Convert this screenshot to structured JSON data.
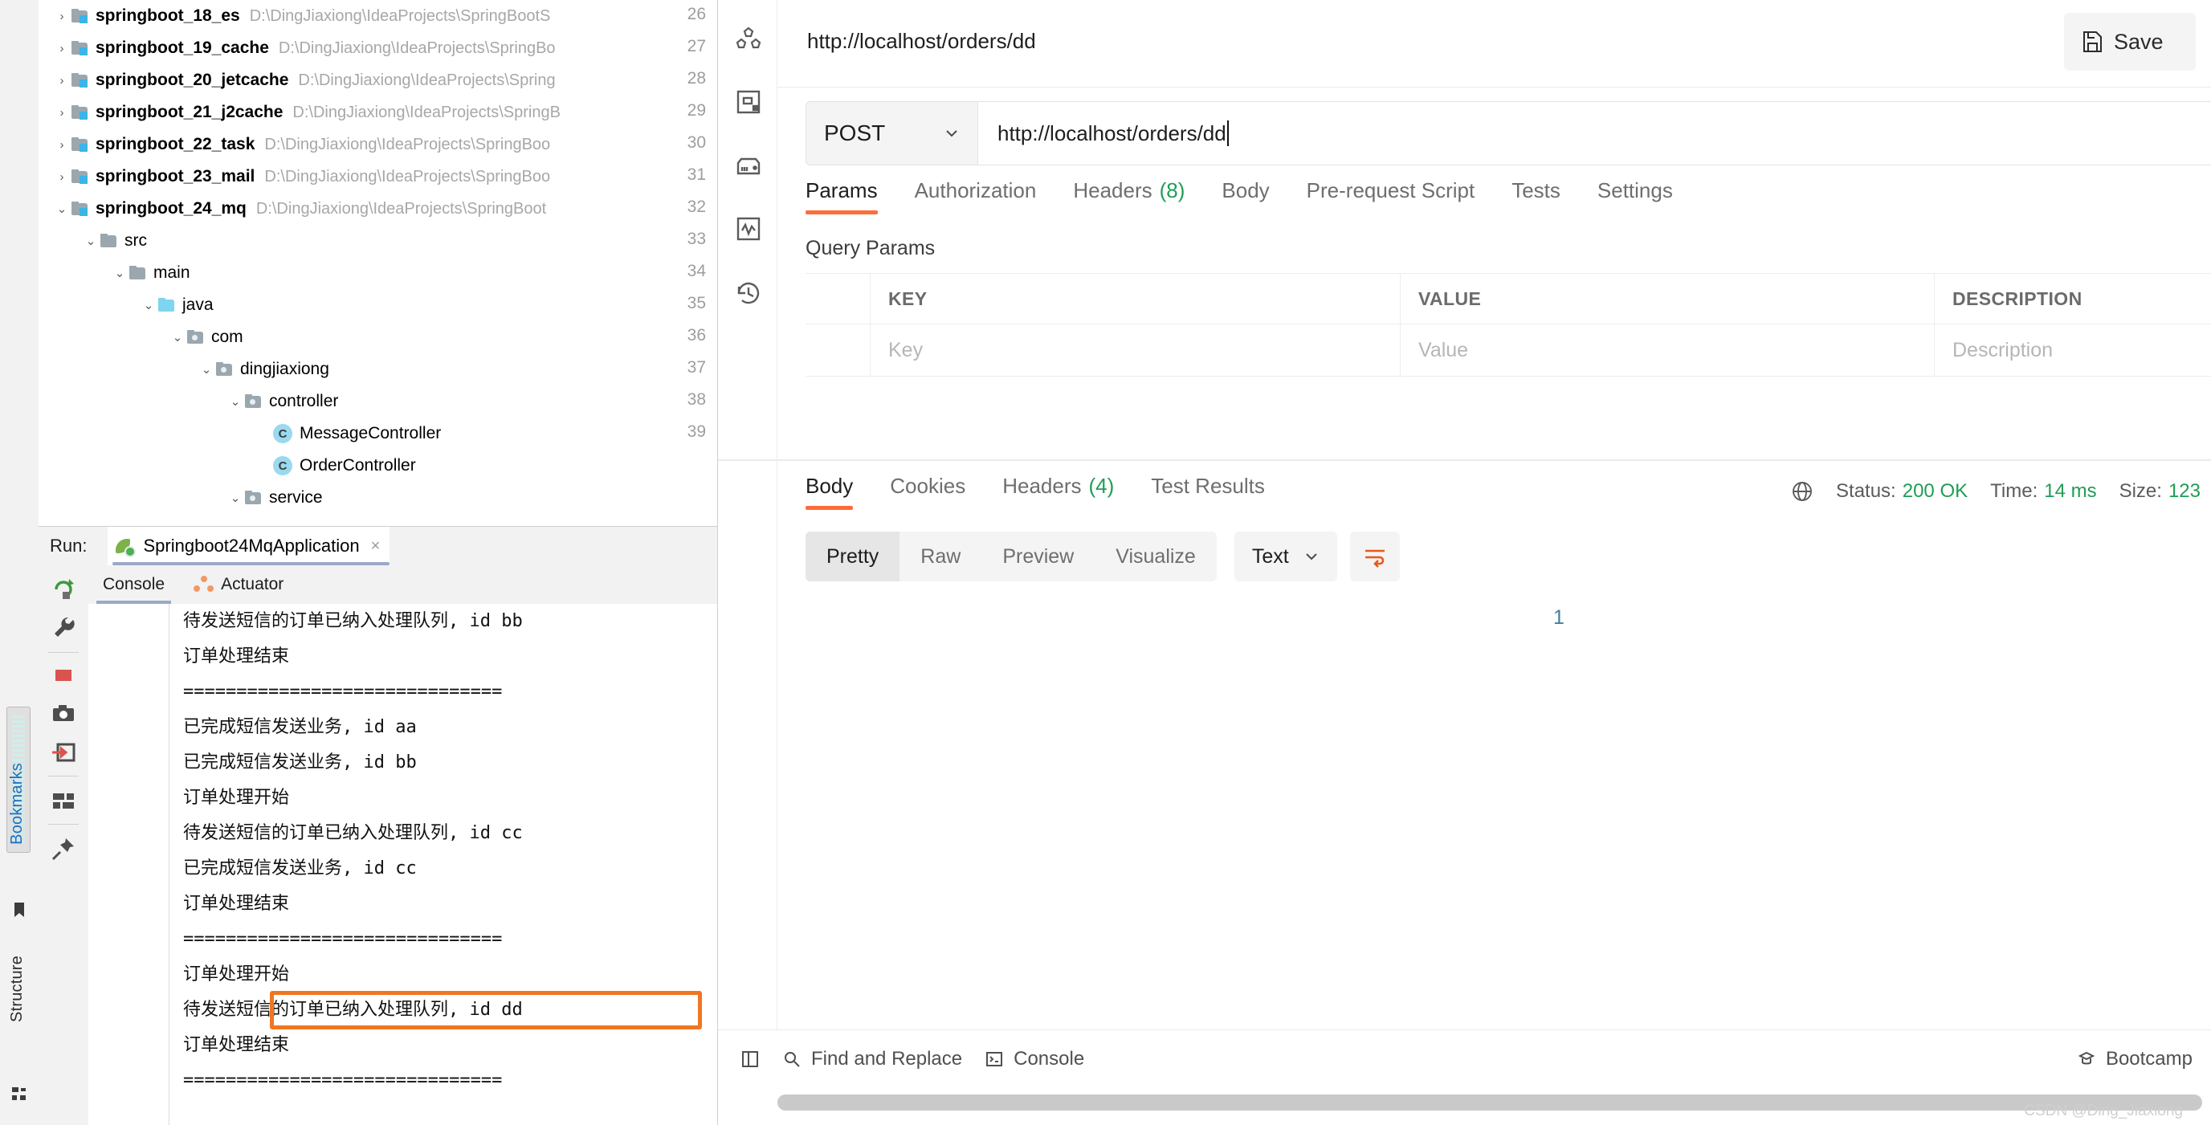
{
  "ide": {
    "rail": {
      "bookmarks_label": "Bookmarks",
      "structure_label": "Structure"
    },
    "tree": [
      {
        "name": "springboot_18_es",
        "path": "D:\\DingJiaxiong\\IdeaProjects\\SpringBootS",
        "indent": 0,
        "chevron": "›",
        "kind": "module"
      },
      {
        "name": "springboot_19_cache",
        "path": "D:\\DingJiaxiong\\IdeaProjects\\SpringBo",
        "indent": 0,
        "chevron": "›",
        "kind": "module"
      },
      {
        "name": "springboot_20_jetcache",
        "path": "D:\\DingJiaxiong\\IdeaProjects\\Spring",
        "indent": 0,
        "chevron": "›",
        "kind": "module"
      },
      {
        "name": "springboot_21_j2cache",
        "path": "D:\\DingJiaxiong\\IdeaProjects\\SpringB",
        "indent": 0,
        "chevron": "›",
        "kind": "module"
      },
      {
        "name": "springboot_22_task",
        "path": "D:\\DingJiaxiong\\IdeaProjects\\SpringBoo",
        "indent": 0,
        "chevron": "›",
        "kind": "module"
      },
      {
        "name": "springboot_23_mail",
        "path": "D:\\DingJiaxiong\\IdeaProjects\\SpringBoo",
        "indent": 0,
        "chevron": "›",
        "kind": "module"
      },
      {
        "name": "springboot_24_mq",
        "path": "D:\\DingJiaxiong\\IdeaProjects\\SpringBoot",
        "indent": 0,
        "chevron": "⌄",
        "kind": "module"
      },
      {
        "name": "src",
        "path": "",
        "indent": 1,
        "chevron": "⌄",
        "kind": "folder"
      },
      {
        "name": "main",
        "path": "",
        "indent": 2,
        "chevron": "⌄",
        "kind": "folder"
      },
      {
        "name": "java",
        "path": "",
        "indent": 3,
        "chevron": "⌄",
        "kind": "java"
      },
      {
        "name": "com",
        "path": "",
        "indent": 4,
        "chevron": "⌄",
        "kind": "package"
      },
      {
        "name": "dingjiaxiong",
        "path": "",
        "indent": 5,
        "chevron": "⌄",
        "kind": "package"
      },
      {
        "name": "controller",
        "path": "",
        "indent": 6,
        "chevron": "⌄",
        "kind": "package"
      },
      {
        "name": "MessageController",
        "path": "",
        "indent": 7,
        "chevron": "",
        "kind": "class"
      },
      {
        "name": "OrderController",
        "path": "",
        "indent": 7,
        "chevron": "",
        "kind": "class"
      },
      {
        "name": "service",
        "path": "",
        "indent": 6,
        "chevron": "⌄",
        "kind": "package"
      }
    ],
    "gutter_lines": [
      "26",
      "27",
      "28",
      "29",
      "30",
      "31",
      "32",
      "33",
      "34",
      "35",
      "36",
      "37",
      "38",
      "39"
    ],
    "run": {
      "run_label": "Run:",
      "config_name": "Springboot24MqApplication",
      "close_label": "×",
      "subtabs": [
        {
          "label": "Console",
          "active": true
        },
        {
          "label": "Actuator",
          "active": false
        }
      ]
    },
    "console_lines": [
      {
        "text": "待发送短信的订单已纳入处理队列, id bb",
        "highlight": false
      },
      {
        "text": "订单处理结束",
        "highlight": false
      },
      {
        "text": "==============================",
        "highlight": false
      },
      {
        "text": "已完成短信发送业务, id aa",
        "highlight": false
      },
      {
        "text": "已完成短信发送业务, id bb",
        "highlight": false
      },
      {
        "text": "订单处理开始",
        "highlight": false
      },
      {
        "text": "待发送短信的订单已纳入处理队列, id cc",
        "highlight": false
      },
      {
        "text": "已完成短信发送业务, id cc",
        "highlight": false
      },
      {
        "text": "订单处理结束",
        "highlight": false
      },
      {
        "text": "==============================",
        "highlight": false
      },
      {
        "text": "订单处理开始",
        "highlight": false
      },
      {
        "text": "待发送短信的订单已纳入处理队列, id dd",
        "highlight": true
      },
      {
        "text": "订单处理结束",
        "highlight": false
      },
      {
        "text": "==============================",
        "highlight": false
      }
    ]
  },
  "postman": {
    "breadcrumb_url": "http://localhost/orders/dd",
    "save_label": "Save",
    "method": "POST",
    "url_value": "http://localhost/orders/dd",
    "request_tabs": [
      {
        "label": "Params",
        "count": "",
        "active": true
      },
      {
        "label": "Authorization",
        "count": "",
        "active": false
      },
      {
        "label": "Headers",
        "count": "(8)",
        "active": false
      },
      {
        "label": "Body",
        "count": "",
        "active": false
      },
      {
        "label": "Pre-request Script",
        "count": "",
        "active": false
      },
      {
        "label": "Tests",
        "count": "",
        "active": false
      },
      {
        "label": "Settings",
        "count": "",
        "active": false
      }
    ],
    "query_params_title": "Query Params",
    "params_table": {
      "headers": [
        "KEY",
        "VALUE",
        "DESCRIPTION"
      ],
      "rows": [
        {
          "key": "Key",
          "value": "Value",
          "description": "Description"
        }
      ]
    },
    "response_tabs": [
      {
        "label": "Body",
        "count": "",
        "active": true
      },
      {
        "label": "Cookies",
        "count": "",
        "active": false
      },
      {
        "label": "Headers",
        "count": "(4)",
        "active": false
      },
      {
        "label": "Test Results",
        "count": "",
        "active": false
      }
    ],
    "response_meta": {
      "status_label": "Status:",
      "status_value": "200 OK",
      "time_label": "Time:",
      "time_value": "14 ms",
      "size_label": "Size:",
      "size_value": "123"
    },
    "view_modes": [
      {
        "label": "Pretty",
        "active": true
      },
      {
        "label": "Raw",
        "active": false
      },
      {
        "label": "Preview",
        "active": false
      },
      {
        "label": "Visualize",
        "active": false
      }
    ],
    "format_select": "Text",
    "body_line_number": "1",
    "status_bar": {
      "find_replace": "Find and Replace",
      "console": "Console",
      "bootcamp": "Bootcamp"
    },
    "watermark": "CSDN @Ding_Jiaxiong",
    "accent_color": "#ff6c37",
    "success_color": "#1f9d55"
  }
}
